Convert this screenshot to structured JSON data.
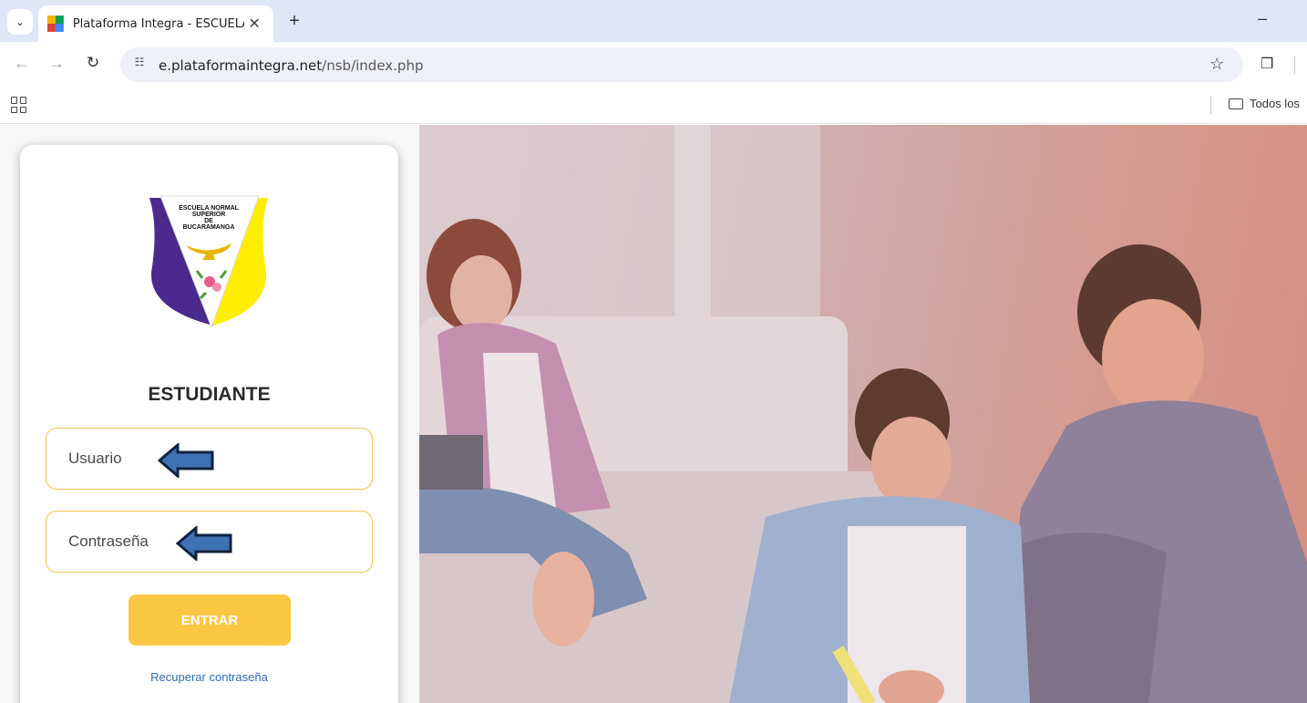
{
  "browser": {
    "tab_title": "Plataforma Integra - ESCUELA N",
    "new_tab_symbol": "+",
    "url_host": "e.plataformaintegra.net",
    "url_path": "/nsb/index.php",
    "bookmark_folder": "Todos los"
  },
  "login": {
    "logo_lines": [
      "ESCUELA NORMAL",
      "SUPERIOR",
      "DE",
      "BUCARAMANGA"
    ],
    "role_title": "ESTUDIANTE",
    "username_placeholder": "Usuario",
    "password_placeholder": "Contraseña",
    "submit_label": "ENTRAR",
    "recover_link": "Recuperar contraseña"
  },
  "colors": {
    "accent_yellow": "#fbc744",
    "field_border": "#f3c44a",
    "crest_purple": "#4a2a8c",
    "crest_yellow": "#ffee00",
    "arrow_blue": "#3f72b4",
    "link_blue": "#2f6db0"
  },
  "icons": [
    "tab-search-icon",
    "favicon-icon",
    "close-icon",
    "back-arrow-icon",
    "forward-arrow-icon",
    "reload-icon",
    "site-info-icon",
    "star-icon",
    "extensions-icon",
    "apps-grid-icon",
    "folder-icon",
    "arrow-left-icon"
  ]
}
